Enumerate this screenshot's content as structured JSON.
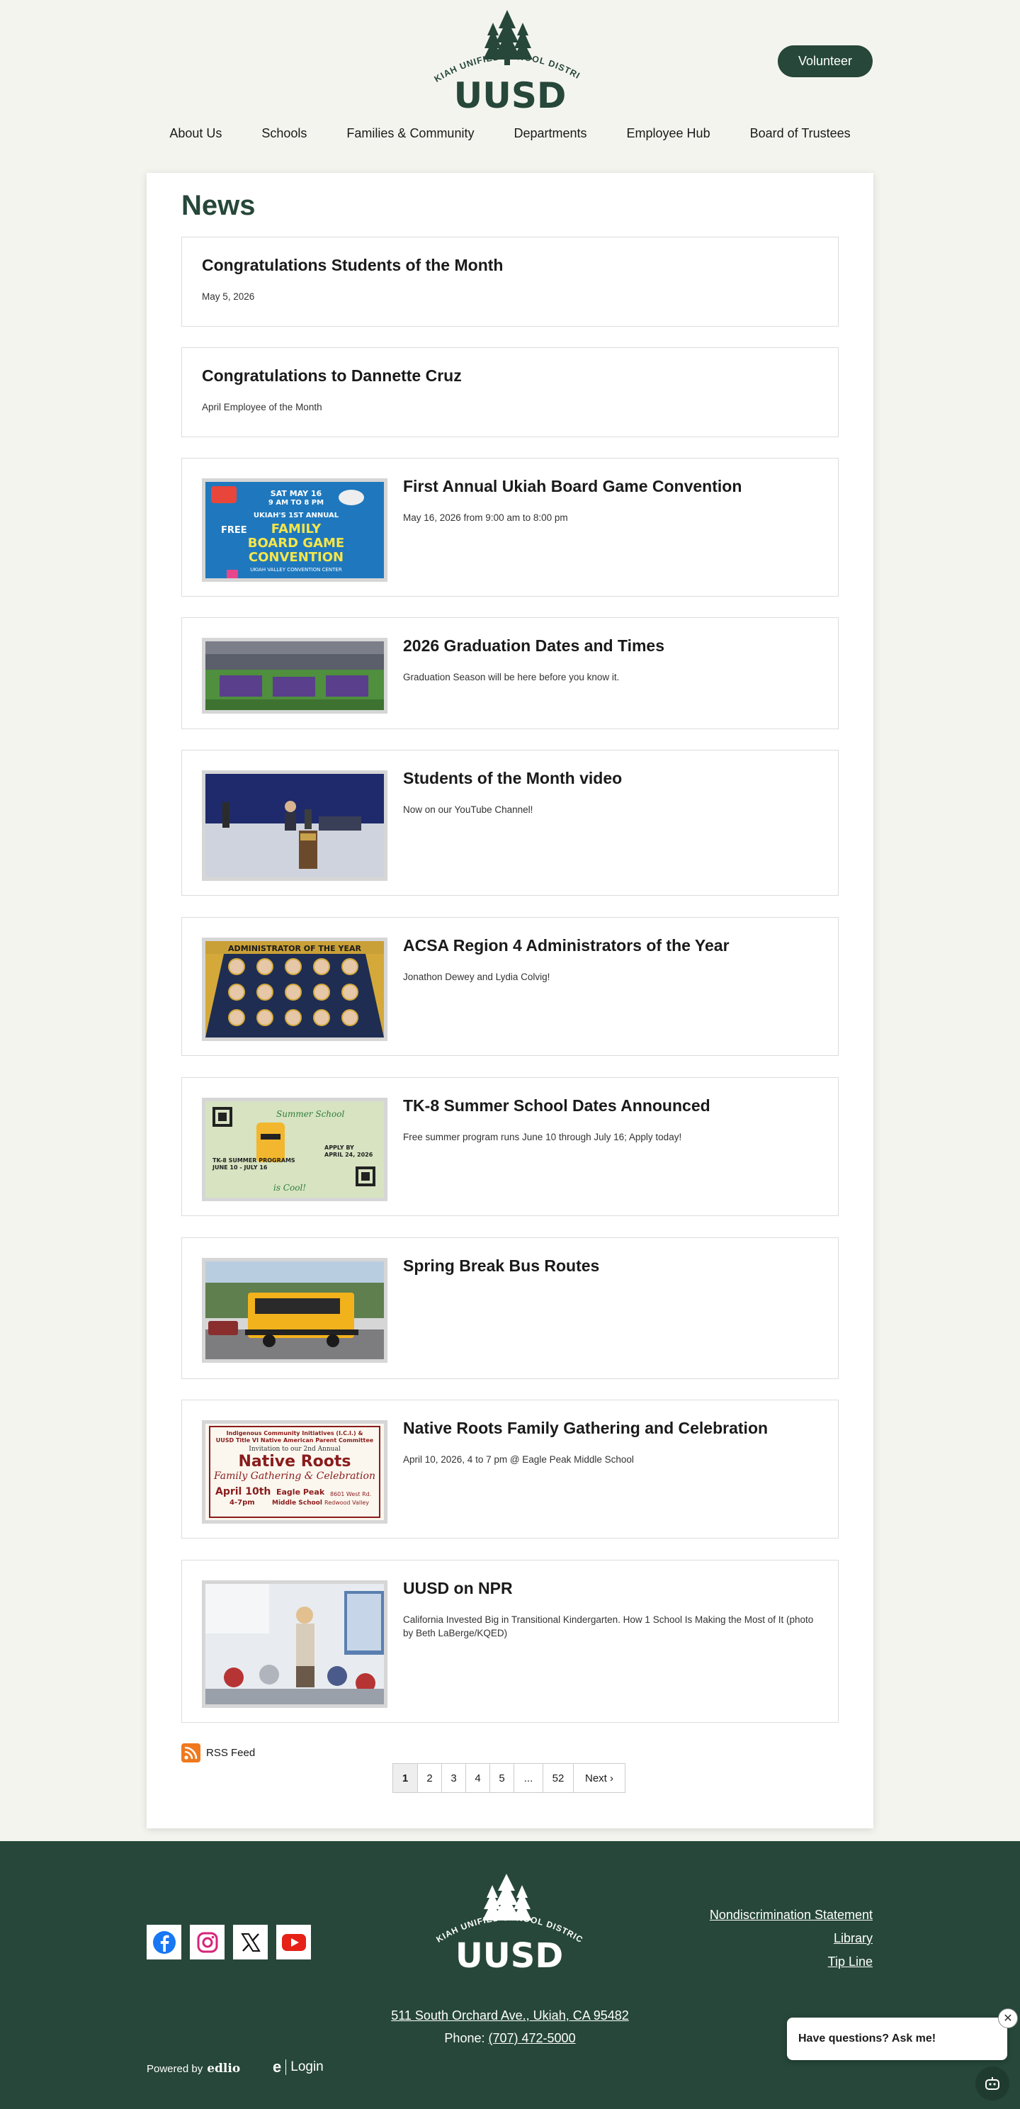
{
  "header": {
    "logo_text": "UKIAH UNIFIED SCHOOL DISTRICT",
    "logo_abbr": "UUSD",
    "volunteer_label": "Volunteer",
    "nav": [
      "About Us",
      "Schools",
      "Families & Community",
      "Departments",
      "Employee Hub",
      "Board of Trustees"
    ]
  },
  "main": {
    "title": "News",
    "articles": [
      {
        "title": "Congratulations Students of the Month",
        "desc": "May 5, 2026",
        "image": ""
      },
      {
        "title": "Congratulations to Dannette Cruz",
        "desc": "April Employee of the Month",
        "image": ""
      },
      {
        "title": "First Annual Ukiah Board Game Convention",
        "desc": "May 16, 2026 from 9:00 am to 8:00 pm",
        "image": "board-game-flyer"
      },
      {
        "title": "2026 Graduation Dates and Times",
        "desc": "Graduation Season will be here before you know it.",
        "image": "graduation-photo"
      },
      {
        "title": "Students of the Month video",
        "desc": "Now on our YouTube Channel!",
        "image": "podium-photo"
      },
      {
        "title": "ACSA Region 4 Administrators of the Year",
        "desc": "Jonathon Dewey and Lydia Colvig!",
        "image": "administrators-graphic"
      },
      {
        "title": "TK-8 Summer School Dates Announced",
        "desc": "Free summer program runs June 10 through July 16; Apply today!",
        "image": "summer-school-flyer"
      },
      {
        "title": "Spring Break Bus Routes",
        "desc": "",
        "image": "school-bus-photo"
      },
      {
        "title": "Native Roots Family Gathering and Celebration",
        "desc": "April 10, 2026, 4 to 7 pm @ Eagle Peak Middle School",
        "image": "native-roots-flyer"
      },
      {
        "title": "UUSD on NPR",
        "desc": "California Invested Big in Transitional Kindergarten. How 1 School Is Making the Most of It (photo by Beth LaBerge/KQED)",
        "image": "classroom-photo"
      }
    ],
    "flyers": {
      "board_game": {
        "line1": "SAT MAY 16",
        "line2": "9 AM TO 8 PM",
        "line3": "UKIAH'S 1ST ANNUAL",
        "line4": "FAMILY",
        "line5": "BOARD GAME",
        "line6": "CONVENTION",
        "line7": "UKIAH VALLEY CONVENTION CENTER",
        "free": "FREE"
      },
      "admins": {
        "header": "ADMINISTRATOR OF THE YEAR"
      },
      "summer": {
        "line1": "Summer School",
        "line2": "TK-8 SUMMER PROGRAMS",
        "line3": "JUNE 10 - JULY 16",
        "line4": "APPLY BY",
        "line5": "APRIL 24, 2026",
        "line6": "is Cool!"
      },
      "native": {
        "line1": "Indigenous Community Initiatives (I.C.I.) &",
        "line2": "UUSD Title VI Native American Parent Committee",
        "line3": "Invitation to our 2nd Annual",
        "line4": "Native Roots",
        "line5": "Family Gathering & Celebration",
        "line6": "April 10th",
        "line7": "4-7pm",
        "line8": "Eagle Peak",
        "line9": "Middle School",
        "line10": "8601 West Rd.",
        "line11": "Redwood Valley"
      }
    },
    "rss_label": "RSS Feed",
    "pagination": [
      "1",
      "2",
      "3",
      "4",
      "5",
      "...",
      "52",
      "Next ›"
    ]
  },
  "footer": {
    "social": [
      "facebook-icon",
      "instagram-icon",
      "x-icon",
      "youtube-icon"
    ],
    "links": [
      "Nondiscrimination Statement",
      "Library",
      "Tip Line"
    ],
    "address": "511 South Orchard Ave., Ukiah, CA 95482",
    "phone_label": "Phone: ",
    "phone": "(707) 472-5000",
    "powered_by": "Powered by",
    "powered_brand": "edlio",
    "login": "Login"
  },
  "chat": {
    "prompt": "Have questions? Ask me!"
  },
  "colors": {
    "brand": "#26473a",
    "background": "#f4f4ef",
    "rss": "#f0791e"
  }
}
